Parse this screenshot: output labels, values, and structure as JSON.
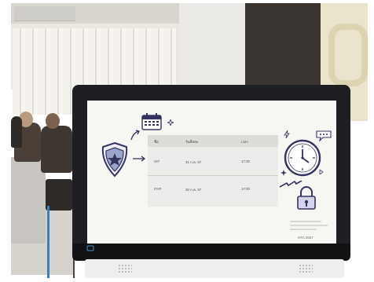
{
  "slide": {
    "table": {
      "headers": [
        "ชื่อ",
        "วันที่สอบ",
        "เวลา"
      ],
      "rows": [
        {
          "name": "OIT",
          "date": "31 ก.ค. 67",
          "time": "17:00"
        },
        {
          "name": "ITAP",
          "date": "30 ก.ค. 67",
          "time": "17:00"
        }
      ]
    },
    "footer": "#ITA 2567"
  },
  "icons": [
    "police-badge-icon",
    "calendar-icon",
    "clock-icon",
    "padlock-icon",
    "arrow-icon",
    "lightning-icon",
    "speech-bubble-icon",
    "sparkle-icon"
  ],
  "colors": {
    "navy": "#34345e",
    "screen_bg": "#f6f6f2",
    "bezel": "#1e1f22"
  }
}
